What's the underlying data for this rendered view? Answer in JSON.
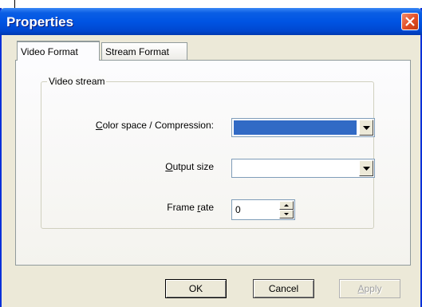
{
  "window": {
    "title": "Properties"
  },
  "tabs": [
    {
      "label": "Video Format",
      "active": true
    },
    {
      "label": "Stream Format",
      "active": false
    }
  ],
  "video_stream": {
    "group_label": "Video stream",
    "color_space": {
      "label_pre": "",
      "label_u": "C",
      "label_post": "olor space / Compression:",
      "value": ""
    },
    "output_size": {
      "label_pre": "",
      "label_u": "O",
      "label_post": "utput size",
      "value": ""
    },
    "frame_rate": {
      "label_pre": "Frame ",
      "label_u": "r",
      "label_post": "ate",
      "value": "0"
    }
  },
  "buttons": {
    "ok": "OK",
    "cancel": "Cancel",
    "apply_u": "A",
    "apply_post": "pply"
  },
  "colors": {
    "titlebar": "#0054e3",
    "selected_fill": "#316ac5",
    "window_bg": "#ece9d8"
  }
}
